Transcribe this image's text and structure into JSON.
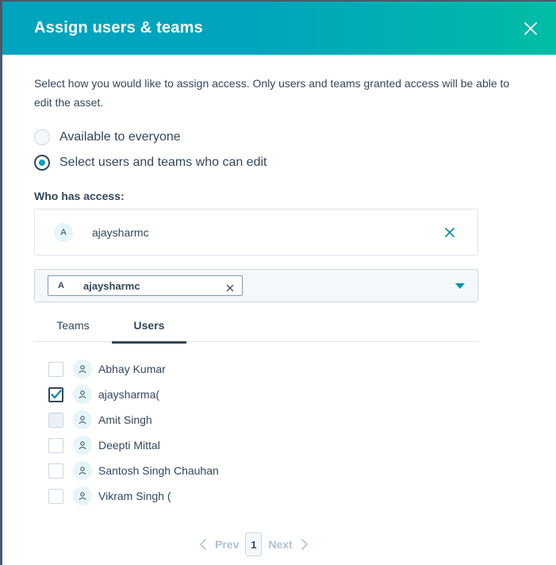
{
  "modal": {
    "title": "Assign users & teams",
    "description": "Select how you would like to assign access. Only users and teams granted access will be able to edit the asset."
  },
  "access_options": [
    {
      "label": "Available to everyone",
      "selected": false
    },
    {
      "label": "Select users and teams who can edit",
      "selected": true
    }
  ],
  "who_has_access": {
    "label": "Who has access:",
    "entries": [
      {
        "avatar": "A",
        "name": "ajaysharmc"
      }
    ]
  },
  "selector": {
    "tags": [
      {
        "avatar": "A",
        "name": "ajaysharmc"
      }
    ]
  },
  "tabs": [
    {
      "label": "Teams",
      "active": false
    },
    {
      "label": "Users",
      "active": true
    }
  ],
  "users": [
    {
      "name": "Abhay Kumar",
      "checked": false
    },
    {
      "name": "ajaysharma(",
      "checked": true
    },
    {
      "name": "Amit Singh",
      "checked": false
    },
    {
      "name": "Deepti Mittal",
      "checked": false
    },
    {
      "name": "Santosh Singh Chauhan",
      "checked": false
    },
    {
      "name": "Vikram Singh (",
      "checked": false
    }
  ],
  "pagination": {
    "prev": "Prev",
    "next": "Next",
    "current_page": "1"
  },
  "colors": {
    "header_start": "#00a4bd",
    "header_end": "#00bda5",
    "text": "#33475b",
    "link": "#0091ae",
    "border": "#dfe3eb"
  }
}
